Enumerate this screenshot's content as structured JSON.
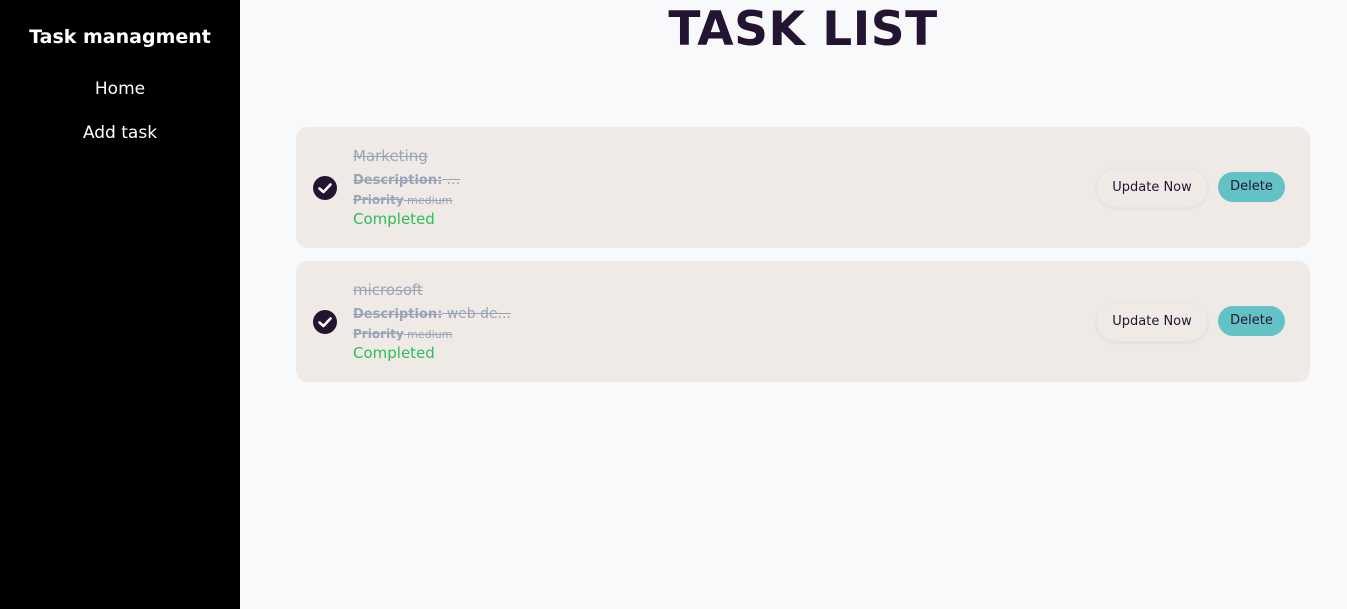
{
  "sidebar": {
    "brand": "Task managment",
    "items": [
      {
        "label": "Home"
      },
      {
        "label": "Add task"
      }
    ]
  },
  "main": {
    "title": "TASK LIST",
    "tasks": [
      {
        "title": "Marketing",
        "description_label": "Description:",
        "description": "...",
        "priority_label": "Priority",
        "priority": "medium",
        "status": "Completed",
        "update_label": "Update Now",
        "delete_label": "Delete"
      },
      {
        "title": "microsoft",
        "description_label": "Description:",
        "description": "web de...",
        "priority_label": "Priority",
        "priority": "medium",
        "status": "Completed",
        "update_label": "Update Now",
        "delete_label": "Delete"
      }
    ]
  },
  "colors": {
    "sidebar_bg": "#000000",
    "title_color": "#231432",
    "card_bg": "#f0eae6",
    "completed_green": "#2ebd59",
    "delete_teal": "#63c2c6"
  }
}
